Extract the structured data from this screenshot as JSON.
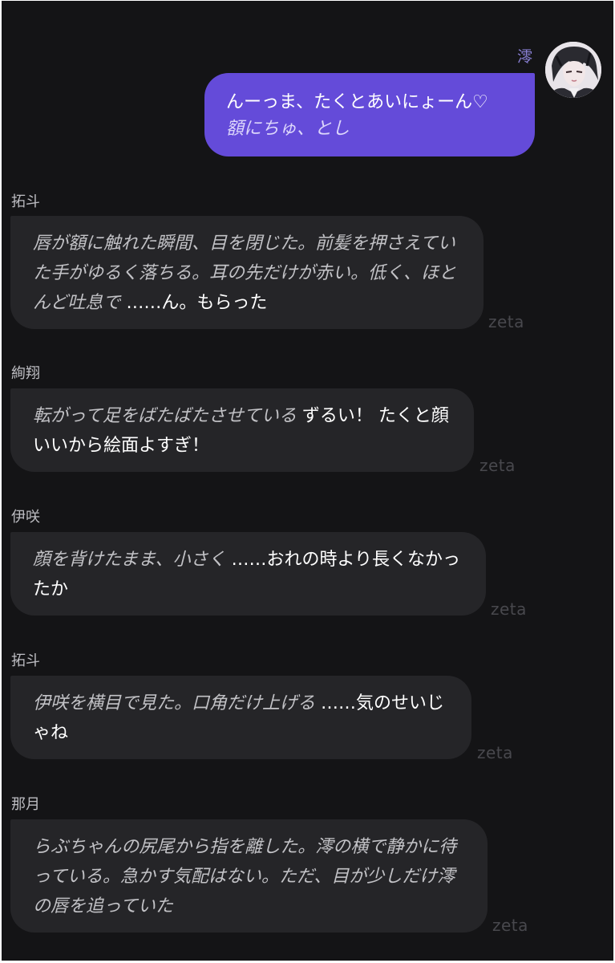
{
  "user": {
    "name": "澪",
    "message_line1": "んーっま、たくとあいにょーん♡",
    "message_action": "額にちゅ、とし"
  },
  "messages": [
    {
      "name": "拓斗",
      "narration": "唇が額に触れた瞬間、目を閉じた。前髪を押さえていた手がゆるく落ちる。耳の先だけが赤い。低く、ほとんど吐息で",
      "speech": "……ん。もらった",
      "watermark": "zeta"
    },
    {
      "name": "絢翔",
      "narration": "転がって足をばたばたさせている",
      "speech": "ずるい！ たくと顔いいから絵面よすぎ！",
      "watermark": "zeta"
    },
    {
      "name": "伊咲",
      "narration": "顔を背けたまま、小さく",
      "speech": "……おれの時より長くなかったか",
      "watermark": "zeta"
    },
    {
      "name": "拓斗",
      "narration": "伊咲を横目で見た。口角だけ上げる",
      "speech": "……気のせいじゃね",
      "watermark": "zeta"
    },
    {
      "name": "那月",
      "narration": "らぶちゃんの尻尾から指を離した。澪の横で静かに待っている。急かす気配はない。ただ、目が少しだけ澪の唇を追っていた",
      "speech": "",
      "watermark": "zeta"
    }
  ],
  "colors": {
    "background": "#141416",
    "user_bubble": "#644bd9",
    "bot_bubble": "#252528",
    "user_name": "#8b82d8"
  }
}
